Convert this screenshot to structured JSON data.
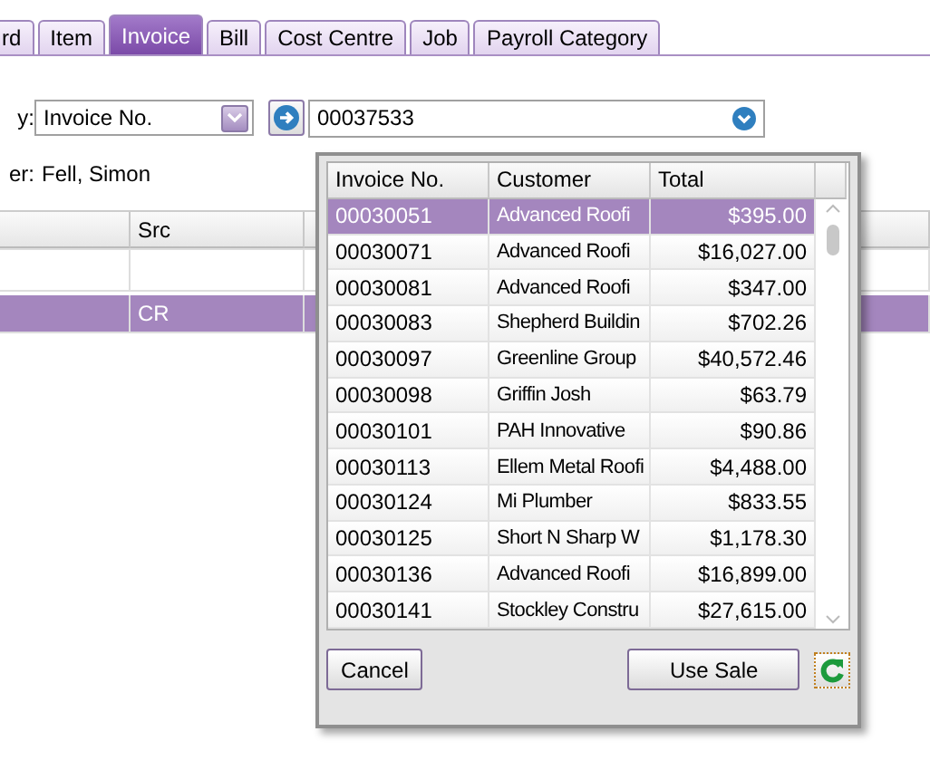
{
  "tabs": [
    {
      "label": "rd",
      "selected": false
    },
    {
      "label": "Item",
      "selected": false
    },
    {
      "label": "Invoice",
      "selected": true
    },
    {
      "label": "Bill",
      "selected": false
    },
    {
      "label": "Cost Centre",
      "selected": false
    },
    {
      "label": "Job",
      "selected": false
    },
    {
      "label": "Payroll Category",
      "selected": false
    }
  ],
  "search": {
    "label": "y:",
    "by": "Invoice No.",
    "value": "00037533"
  },
  "customer": {
    "label": "er:",
    "value": "Fell, Simon"
  },
  "table": {
    "columns": [
      "Src"
    ],
    "rows": [
      {
        "cells": [
          "",
          "CR"
        ],
        "selected": true
      }
    ]
  },
  "lookup": {
    "columns": [
      "Invoice No.",
      "Customer",
      "Total"
    ],
    "rows": [
      {
        "invoice": "00030051",
        "customer": "Advanced  Roofi",
        "total": "$395.00",
        "selected": true
      },
      {
        "invoice": "00030071",
        "customer": "Advanced  Roofi",
        "total": "$16,027.00",
        "selected": false
      },
      {
        "invoice": "00030081",
        "customer": "Advanced  Roofi",
        "total": "$347.00",
        "selected": false
      },
      {
        "invoice": "00030083",
        "customer": "Shepherd Buildin",
        "total": "$702.26",
        "selected": false
      },
      {
        "invoice": "00030097",
        "customer": "Greenline Group",
        "total": "$40,572.46",
        "selected": false
      },
      {
        "invoice": "00030098",
        "customer": "Griffin Josh",
        "total": "$63.79",
        "selected": false
      },
      {
        "invoice": "00030101",
        "customer": "PAH Innovative",
        "total": "$90.86",
        "selected": false
      },
      {
        "invoice": "00030113",
        "customer": "Ellem Metal Roofi",
        "total": "$4,488.00",
        "selected": false
      },
      {
        "invoice": "00030124",
        "customer": "Mi Plumber",
        "total": "$833.55",
        "selected": false
      },
      {
        "invoice": "00030125",
        "customer": "Short N Sharp W",
        "total": "$1,178.30",
        "selected": false
      },
      {
        "invoice": "00030136",
        "customer": "Advanced  Roofi",
        "total": "$16,899.00",
        "selected": false
      },
      {
        "invoice": "00030141",
        "customer": "Stockley Constru",
        "total": "$27,615.00",
        "selected": false
      }
    ],
    "buttons": [
      "Cancel",
      "Use Sale"
    ]
  }
}
